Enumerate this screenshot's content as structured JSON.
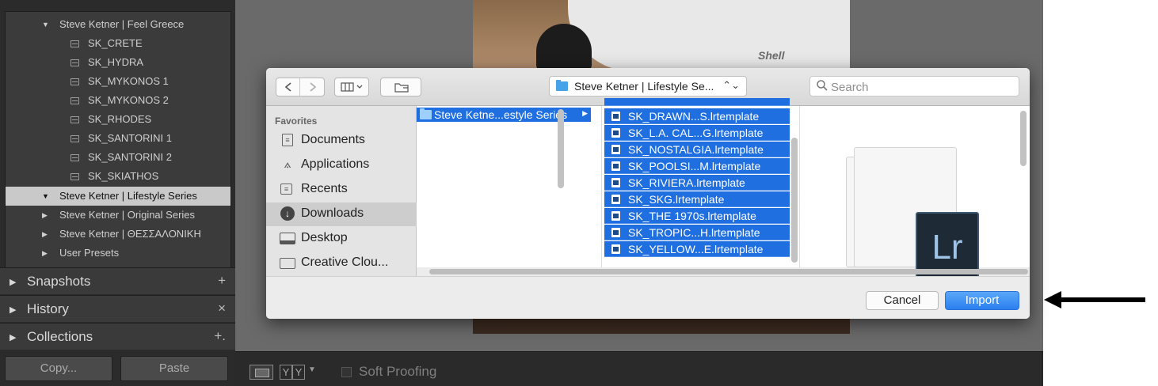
{
  "lightroom": {
    "preset_tree": {
      "items": [
        {
          "label": "Steve Ketner | Feel Greece",
          "type": "folder",
          "state": "expanded"
        },
        {
          "label": "SK_CRETE",
          "type": "preset"
        },
        {
          "label": "SK_HYDRA",
          "type": "preset"
        },
        {
          "label": "SK_MYKONOS 1",
          "type": "preset"
        },
        {
          "label": "SK_MYKONOS 2",
          "type": "preset"
        },
        {
          "label": "SK_RHODES",
          "type": "preset"
        },
        {
          "label": "SK_SANTORINI 1",
          "type": "preset"
        },
        {
          "label": "SK_SANTORINI 2",
          "type": "preset"
        },
        {
          "label": "SK_SKIATHOS",
          "type": "preset"
        },
        {
          "label": "Steve Ketner | Lifestyle Series",
          "type": "folder",
          "state": "expanded",
          "selected": true
        },
        {
          "label": "Steve Ketner | Original Series",
          "type": "folder",
          "state": "collapsed"
        },
        {
          "label": "Steve Ketner | ΘΕΣΣΑΛΟΝΙΚΗ",
          "type": "folder",
          "state": "collapsed"
        },
        {
          "label": "User Presets",
          "type": "folder",
          "state": "collapsed"
        }
      ]
    },
    "panels": [
      {
        "label": "Snapshots",
        "button": "+"
      },
      {
        "label": "History",
        "button": "×"
      },
      {
        "label": "Collections",
        "button": "+."
      }
    ],
    "copy_label": "Copy...",
    "paste_label": "Paste",
    "toolbar": {
      "yy1": "Y",
      "yy2": "Y",
      "soft_proofing_label": "Soft Proofing"
    },
    "photo": {
      "logo_text": "Shell"
    }
  },
  "dialog": {
    "path_label": "Steve Ketner | Lifestyle Se...",
    "search_placeholder": "Search",
    "sidebar": {
      "heading": "Favorites",
      "items": [
        {
          "label": "Documents",
          "icon": "documents-icon"
        },
        {
          "label": "Applications",
          "icon": "applications-icon"
        },
        {
          "label": "Recents",
          "icon": "recents-icon"
        },
        {
          "label": "Downloads",
          "icon": "downloads-icon",
          "selected": true
        },
        {
          "label": "Desktop",
          "icon": "desktop-icon"
        },
        {
          "label": "Creative Clou...",
          "icon": "folder-icon"
        }
      ]
    },
    "column1": {
      "items": [
        {
          "label": "Steve Ketne...estyle Series",
          "selected": true
        }
      ]
    },
    "column2": {
      "files": [
        "SK_DRAWN...S.lrtemplate",
        "SK_L.A. CAL...G.lrtemplate",
        "SK_NOSTALGIA.lrtemplate",
        "SK_POOLSI...M.lrtemplate",
        "SK_RIVIERA.lrtemplate",
        "SK_SKG.lrtemplate",
        "SK_THE 1970s.lrtemplate",
        "SK_TROPIC...H.lrtemplate",
        "SK_YELLOW...E.lrtemplate"
      ]
    },
    "preview": {
      "logo_text": "Lr"
    },
    "cancel_label": "Cancel",
    "import_label": "Import"
  },
  "colors": {
    "selection_blue": "#1f6fe0",
    "import_blue": "#2b7ff0",
    "lightroom_panel": "#3b3b3b"
  }
}
